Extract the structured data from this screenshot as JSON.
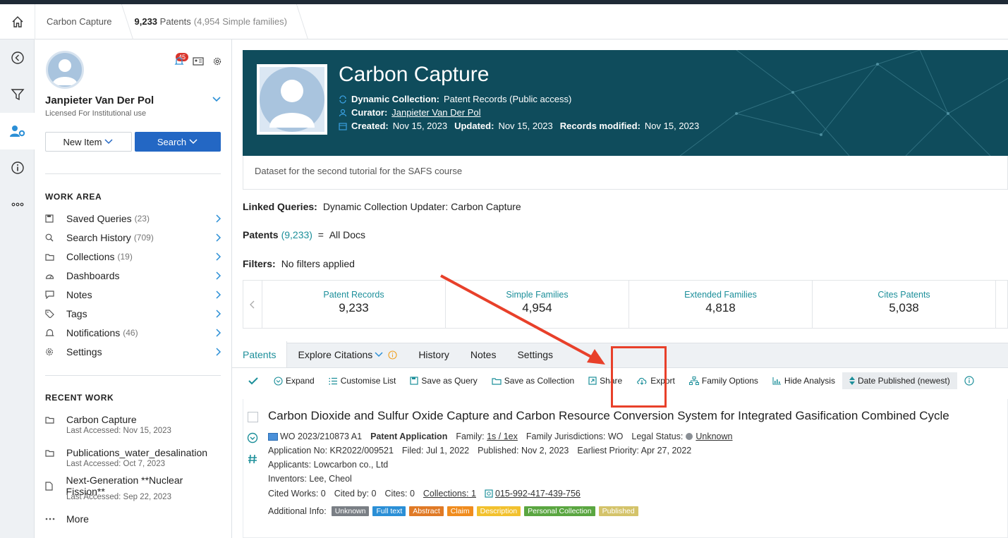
{
  "breadcrumb": {
    "collection": "Carbon Capture",
    "count": "9,233",
    "count_label": "Patents",
    "families": "(4,954 Simple families)"
  },
  "user": {
    "name": "Janpieter Van Der Pol",
    "license": "Licensed For Institutional use",
    "notifications_badge": "45"
  },
  "buttons": {
    "new_item": "New Item",
    "search": "Search"
  },
  "work_area": {
    "heading": "WORK AREA",
    "items": [
      {
        "label": "Saved Queries",
        "count": "(23)"
      },
      {
        "label": "Search History",
        "count": "(709)"
      },
      {
        "label": "Collections",
        "count": "(19)"
      },
      {
        "label": "Dashboards",
        "count": ""
      },
      {
        "label": "Notes",
        "count": ""
      },
      {
        "label": "Tags",
        "count": ""
      },
      {
        "label": "Notifications",
        "count": "(46)"
      },
      {
        "label": "Settings",
        "count": ""
      }
    ]
  },
  "recent_work": {
    "heading": "RECENT WORK",
    "items": [
      {
        "title": "Carbon Capture",
        "sub": "Last Accessed: Nov 15, 2023"
      },
      {
        "title": "Publications_water_desalination",
        "sub": "Last Accessed: Oct 7, 2023"
      },
      {
        "title": "Next-Generation **Nuclear Fission**",
        "sub": "Last Accessed: Sep 22, 2023"
      }
    ],
    "more": "More"
  },
  "hero": {
    "title": "Carbon Capture",
    "dynamic_label": "Dynamic Collection:",
    "dynamic_value": "Patent Records (Public access)",
    "curator_label": "Curator:",
    "curator_value": "Janpieter Van Der Pol",
    "created_label": "Created:",
    "created_value": "Nov 15, 2023",
    "updated_label": "Updated:",
    "updated_value": "Nov 15, 2023",
    "modified_label": "Records modified:",
    "modified_value": "Nov 15, 2023"
  },
  "description": "Dataset for the second tutorial for the SAFS course",
  "linked_queries": {
    "label": "Linked Queries:",
    "value": "Dynamic Collection Updater: Carbon Capture"
  },
  "patents_line": {
    "label": "Patents",
    "count": "(9,233)",
    "eq": "=",
    "value": "All Docs"
  },
  "filters_line": {
    "label": "Filters:",
    "value": "No filters applied"
  },
  "stats": [
    {
      "label": "Patent Records",
      "value": "9,233"
    },
    {
      "label": "Simple Families",
      "value": "4,954"
    },
    {
      "label": "Extended Families",
      "value": "4,818"
    },
    {
      "label": "Cites Patents",
      "value": "5,038"
    }
  ],
  "tabs": [
    "Patents",
    "Explore Citations",
    "History",
    "Notes",
    "Settings"
  ],
  "toolbar": {
    "expand": "Expand",
    "customise": "Customise List",
    "save_query": "Save as Query",
    "save_collection": "Save as Collection",
    "share": "Share",
    "export": "Export",
    "family_options": "Family Options",
    "hide_analysis": "Hide Analysis",
    "sort": "Date Published (newest)"
  },
  "result": {
    "title": "Carbon Dioxide and Sulfur Oxide Capture and Carbon Resource Conversion System for Integrated Gasification Combined Cycle",
    "pub_number": "WO 2023/210873 A1",
    "type": "Patent Application",
    "family_label": "Family:",
    "family_value": "1s / 1ex",
    "jurisdictions": "Family Jurisdictions: WO",
    "legal_label": "Legal Status:",
    "legal_value": "Unknown",
    "application_no": "Application No: KR2022/009521",
    "filed": "Filed: Jul 1, 2022",
    "published": "Published: Nov 2, 2023",
    "earliest": "Earliest Priority: Apr 27, 2022",
    "applicants": "Applicants: Lowcarbon co., Ltd",
    "inventors": "Inventors: Lee, Cheol",
    "cited_works": "Cited Works: 0",
    "cited_by": "Cited by: 0",
    "cites": "Cites: 0",
    "collections": "Collections: 1",
    "lens_id": "015-992-417-439-756",
    "additional_label": "Additional Info:",
    "tags": [
      {
        "label": "Unknown",
        "color": "#7a7f85"
      },
      {
        "label": "Full text",
        "color": "#2b8fd6"
      },
      {
        "label": "Abstract",
        "color": "#e07a26"
      },
      {
        "label": "Claim",
        "color": "#f08c1e"
      },
      {
        "label": "Description",
        "color": "#f2c12e"
      },
      {
        "label": "Personal Collection",
        "color": "#5aa641"
      },
      {
        "label": "Published",
        "color": "#d4c36a"
      }
    ]
  },
  "colors": {
    "accent": "#1c8f9a",
    "primary": "#2367c4",
    "hero_bg": "#0f4c5c",
    "annotation": "#e8402a"
  }
}
